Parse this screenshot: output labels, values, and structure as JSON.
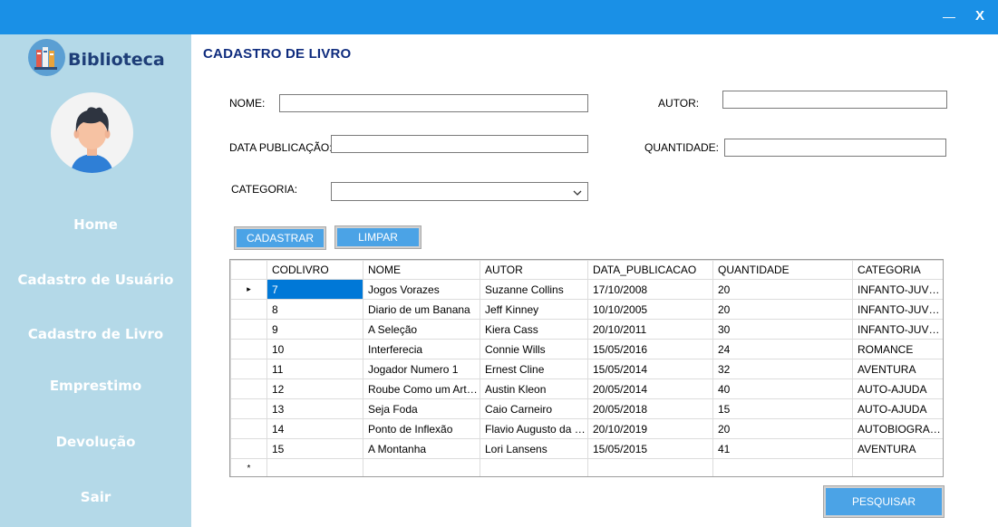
{
  "window": {
    "minimize_glyph": "—",
    "close_glyph": "X"
  },
  "sidebar": {
    "logo_text": "Biblioteca",
    "items": [
      {
        "label": "Home"
      },
      {
        "label": "Cadastro de Usuário"
      },
      {
        "label": "Cadastro de Livro"
      },
      {
        "label": "Emprestimo"
      },
      {
        "label": "Devolução"
      },
      {
        "label": "Sair"
      }
    ]
  },
  "form": {
    "title": "CADASTRO DE LIVRO",
    "nome_label": "NOME:",
    "nome_value": "",
    "autor_label": "AUTOR:",
    "autor_value": "",
    "data_label": "DATA PUBLICAÇÃO:",
    "data_value": "",
    "quantidade_label": "QUANTIDADE:",
    "quantidade_value": "",
    "categoria_label": "CATEGORIA:",
    "categoria_value": "",
    "cadastrar_label": "CADASTRAR",
    "limpar_label": "LIMPAR",
    "pesquisar_label": "PESQUISAR"
  },
  "grid": {
    "columns": [
      "CODLIVRO",
      "NOME",
      "AUTOR",
      "DATA_PUBLICACAO",
      "QUANTIDADE",
      "CATEGORIA"
    ],
    "current_row_marker": "▸",
    "new_row_marker": "*",
    "rows": [
      [
        "7",
        "Jogos Vorazes",
        "Suzanne Collins",
        "17/10/2008",
        "20",
        "INFANTO-JUVE..."
      ],
      [
        "8",
        "Diario de um Banana",
        "Jeff Kinney",
        "10/10/2005",
        "20",
        "INFANTO-JUVE..."
      ],
      [
        "9",
        "A Seleção",
        "Kiera Cass",
        "20/10/2011",
        "30",
        "INFANTO-JUVE..."
      ],
      [
        "10",
        "Interferecia",
        "Connie Wills",
        "15/05/2016",
        "24",
        "ROMANCE"
      ],
      [
        "11",
        "Jogador Numero 1",
        "Ernest Cline",
        "15/05/2014",
        "32",
        "AVENTURA"
      ],
      [
        "12",
        "Roube Como um Artista",
        "Austin Kleon",
        "20/05/2014",
        "40",
        "AUTO-AJUDA"
      ],
      [
        "13",
        "Seja Foda",
        "Caio Carneiro",
        "20/05/2018",
        "15",
        "AUTO-AJUDA"
      ],
      [
        "14",
        "Ponto de Inflexão",
        "Flavio Augusto da Silva",
        "20/10/2019",
        "20",
        "AUTOBIOGRAFIA"
      ],
      [
        "15",
        "A Montanha",
        "Lori Lansens",
        "15/05/2015",
        "41",
        "AVENTURA"
      ]
    ]
  },
  "colors": {
    "titlebar": "#1a90e6",
    "sidebar": "#b4d9e8",
    "button": "#4ba3e6",
    "title_text": "#0f2c7e",
    "selection": "#0078d7"
  }
}
